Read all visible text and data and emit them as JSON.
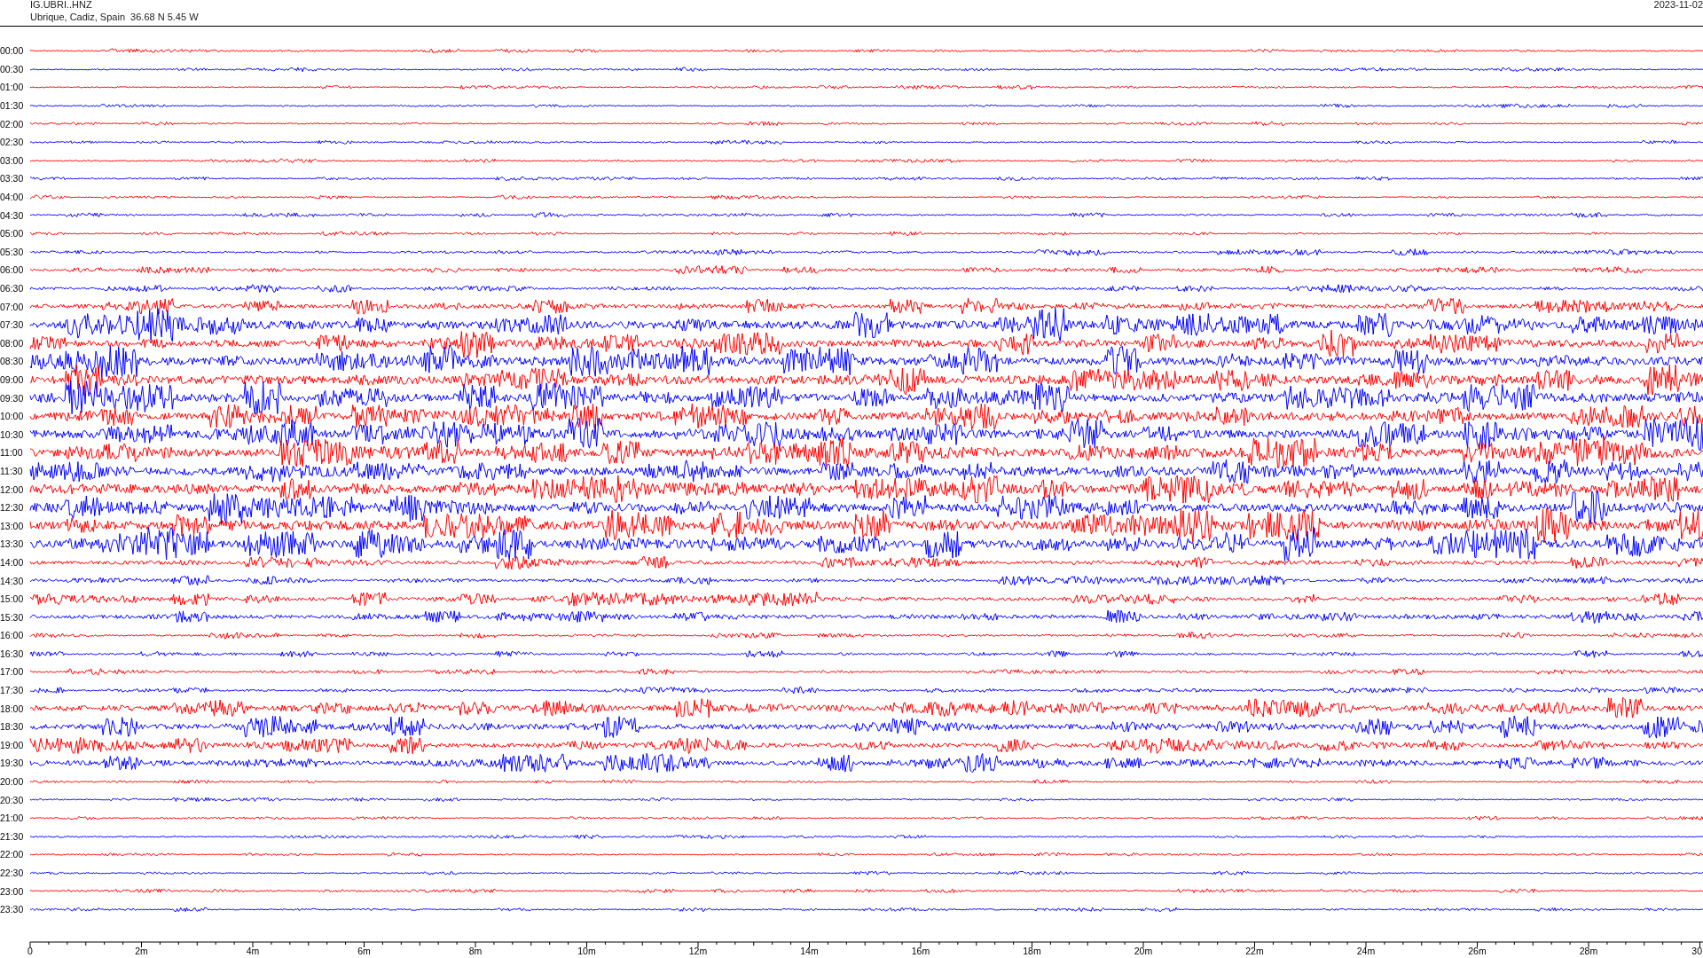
{
  "header": {
    "station": "IG.UBRI..HNZ",
    "location": "Ubrique, Cadiz, Spain  36.68 N 5.45 W",
    "date": "2023-11-02"
  },
  "rows": [
    {
      "time": "00:00",
      "color": "#ff0000"
    },
    {
      "time": "00:30",
      "color": "#0000ff"
    },
    {
      "time": "01:00",
      "color": "#ff0000"
    },
    {
      "time": "01:30",
      "color": "#0000ff"
    },
    {
      "time": "02:00",
      "color": "#ff0000"
    },
    {
      "time": "02:30",
      "color": "#0000ff"
    },
    {
      "time": "03:00",
      "color": "#ff0000"
    },
    {
      "time": "03:30",
      "color": "#0000ff"
    },
    {
      "time": "04:00",
      "color": "#ff0000"
    },
    {
      "time": "04:30",
      "color": "#0000ff"
    },
    {
      "time": "05:00",
      "color": "#ff0000"
    },
    {
      "time": "05:30",
      "color": "#0000ff"
    },
    {
      "time": "06:00",
      "color": "#ff0000"
    },
    {
      "time": "06:30",
      "color": "#0000ff"
    },
    {
      "time": "07:00",
      "color": "#ff0000"
    },
    {
      "time": "07:30",
      "color": "#0000ff"
    },
    {
      "time": "08:00",
      "color": "#ff0000"
    },
    {
      "time": "08:30",
      "color": "#0000ff"
    },
    {
      "time": "09:00",
      "color": "#ff0000"
    },
    {
      "time": "09:30",
      "color": "#0000ff"
    },
    {
      "time": "10:00",
      "color": "#ff0000"
    },
    {
      "time": "10:30",
      "color": "#0000ff"
    },
    {
      "time": "11:00",
      "color": "#ff0000"
    },
    {
      "time": "11:30",
      "color": "#0000ff"
    },
    {
      "time": "12:00",
      "color": "#ff0000"
    },
    {
      "time": "12:30",
      "color": "#0000ff"
    },
    {
      "time": "13:00",
      "color": "#ff0000"
    },
    {
      "time": "13:30",
      "color": "#0000ff"
    },
    {
      "time": "14:00",
      "color": "#ff0000"
    },
    {
      "time": "14:30",
      "color": "#0000ff"
    },
    {
      "time": "15:00",
      "color": "#ff0000"
    },
    {
      "time": "15:30",
      "color": "#0000ff"
    },
    {
      "time": "16:00",
      "color": "#ff0000"
    },
    {
      "time": "16:30",
      "color": "#0000ff"
    },
    {
      "time": "17:00",
      "color": "#ff0000"
    },
    {
      "time": "17:30",
      "color": "#0000ff"
    },
    {
      "time": "18:00",
      "color": "#ff0000"
    },
    {
      "time": "18:30",
      "color": "#0000ff"
    },
    {
      "time": "19:00",
      "color": "#ff0000"
    },
    {
      "time": "19:30",
      "color": "#0000ff"
    },
    {
      "time": "20:00",
      "color": "#ff0000"
    },
    {
      "time": "20:30",
      "color": "#0000ff"
    },
    {
      "time": "21:00",
      "color": "#ff0000"
    },
    {
      "time": "21:30",
      "color": "#0000ff"
    },
    {
      "time": "22:00",
      "color": "#ff0000"
    },
    {
      "time": "22:30",
      "color": "#0000ff"
    },
    {
      "time": "23:00",
      "color": "#ff0000"
    },
    {
      "time": "23:30",
      "color": "#0000ff"
    }
  ],
  "time_axis": {
    "labels": [
      "0",
      "2m",
      "4m",
      "6m",
      "8m",
      "10m",
      "12m",
      "14m",
      "16m",
      "18m",
      "20m",
      "22m",
      "24m",
      "26m",
      "28m",
      "30"
    ]
  }
}
